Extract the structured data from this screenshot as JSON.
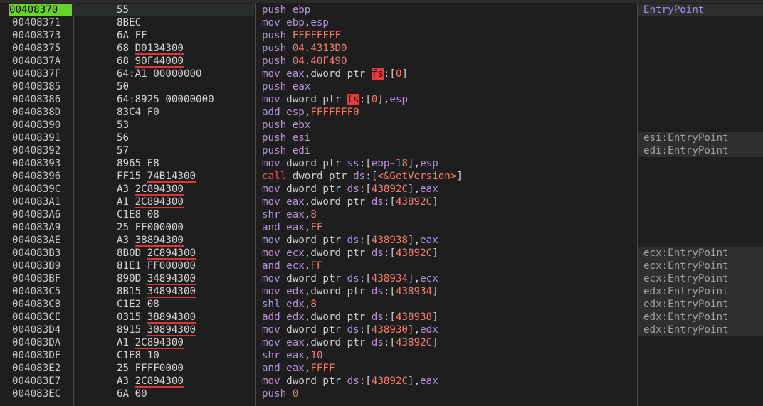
{
  "rows": [
    {
      "addr": "00408370",
      "bytes": [
        [
          "55"
        ]
      ],
      "instr": [
        [
          "mn",
          "push"
        ],
        [
          "s",
          " "
        ],
        [
          "r",
          "ebp"
        ]
      ],
      "comment": "EntryPoint",
      "selected": true
    },
    {
      "addr": "00408371",
      "bytes": [
        [
          "8BEC"
        ]
      ],
      "instr": [
        [
          "mn",
          "mov"
        ],
        [
          "s",
          " "
        ],
        [
          "r",
          "ebp"
        ],
        [
          "p",
          ","
        ],
        [
          "r",
          "esp"
        ]
      ],
      "comment": ""
    },
    {
      "addr": "00408373",
      "bytes": [
        [
          "6A FF"
        ]
      ],
      "instr": [
        [
          "mn",
          "push"
        ],
        [
          "s",
          " "
        ],
        [
          "n",
          "FFFFFFFF"
        ]
      ],
      "comment": ""
    },
    {
      "addr": "00408375",
      "bytes": [
        [
          "68 "
        ],
        [
          "u",
          "D0134300"
        ]
      ],
      "instr": [
        [
          "mn",
          "push"
        ],
        [
          "s",
          " "
        ],
        [
          "n",
          "04.4313D0"
        ]
      ],
      "comment": ""
    },
    {
      "addr": "0040837A",
      "bytes": [
        [
          "68 "
        ],
        [
          "u",
          "90F44000"
        ]
      ],
      "instr": [
        [
          "mn",
          "push"
        ],
        [
          "s",
          " "
        ],
        [
          "n",
          "04.40F490"
        ]
      ],
      "comment": ""
    },
    {
      "addr": "0040837F",
      "bytes": [
        [
          "64:A1 00000000"
        ]
      ],
      "instr": [
        [
          "mn",
          "mov"
        ],
        [
          "s",
          " "
        ],
        [
          "r",
          "eax"
        ],
        [
          "p",
          ","
        ],
        [
          "p",
          "dword ptr "
        ],
        [
          "fs",
          "fs"
        ],
        [
          "p",
          ":["
        ],
        [
          "n",
          "0"
        ],
        [
          "p",
          "]"
        ]
      ],
      "comment": ""
    },
    {
      "addr": "00408385",
      "bytes": [
        [
          "50"
        ]
      ],
      "instr": [
        [
          "mn",
          "push"
        ],
        [
          "s",
          " "
        ],
        [
          "r",
          "eax"
        ]
      ],
      "comment": ""
    },
    {
      "addr": "00408386",
      "bytes": [
        [
          "64:8925 00000000"
        ]
      ],
      "instr": [
        [
          "mn",
          "mov"
        ],
        [
          "s",
          " "
        ],
        [
          "p",
          "dword ptr "
        ],
        [
          "fs",
          "fs"
        ],
        [
          "p",
          ":["
        ],
        [
          "n",
          "0"
        ],
        [
          "p",
          "],"
        ],
        [
          "r",
          "esp"
        ]
      ],
      "comment": ""
    },
    {
      "addr": "0040838D",
      "bytes": [
        [
          "83C4 F0"
        ]
      ],
      "instr": [
        [
          "mn",
          "add"
        ],
        [
          "s",
          " "
        ],
        [
          "r",
          "esp"
        ],
        [
          "p",
          ","
        ],
        [
          "n",
          "FFFFFFF0"
        ]
      ],
      "comment": ""
    },
    {
      "addr": "00408390",
      "bytes": [
        [
          "53"
        ]
      ],
      "instr": [
        [
          "mn",
          "push"
        ],
        [
          "s",
          " "
        ],
        [
          "r",
          "ebx"
        ]
      ],
      "comment": ""
    },
    {
      "addr": "00408391",
      "bytes": [
        [
          "56"
        ]
      ],
      "instr": [
        [
          "mn",
          "push"
        ],
        [
          "s",
          " "
        ],
        [
          "r",
          "esi"
        ]
      ],
      "comment": "esi:EntryPoint"
    },
    {
      "addr": "00408392",
      "bytes": [
        [
          "57"
        ]
      ],
      "instr": [
        [
          "mn",
          "push"
        ],
        [
          "s",
          " "
        ],
        [
          "r",
          "edi"
        ]
      ],
      "comment": "edi:EntryPoint"
    },
    {
      "addr": "00408393",
      "bytes": [
        [
          "8965 E8"
        ]
      ],
      "instr": [
        [
          "mn",
          "mov"
        ],
        [
          "s",
          " "
        ],
        [
          "p",
          "dword ptr "
        ],
        [
          "seg",
          "ss"
        ],
        [
          "p",
          ":["
        ],
        [
          "r",
          "ebp"
        ],
        [
          "p",
          "-"
        ],
        [
          "n",
          "18"
        ],
        [
          "p",
          "],"
        ],
        [
          "r",
          "esp"
        ]
      ],
      "comment": ""
    },
    {
      "addr": "00408396",
      "bytes": [
        [
          "FF15 "
        ],
        [
          "u",
          "74B14300"
        ]
      ],
      "instr": [
        [
          "call",
          "call"
        ],
        [
          "s",
          " "
        ],
        [
          "p",
          "dword ptr "
        ],
        [
          "seg",
          "ds"
        ],
        [
          "p",
          ":["
        ],
        [
          "sym",
          "<&GetVersion>"
        ],
        [
          "p",
          "]"
        ]
      ],
      "comment": ""
    },
    {
      "addr": "0040839C",
      "bytes": [
        [
          "A3 "
        ],
        [
          "u",
          "2C894300"
        ]
      ],
      "instr": [
        [
          "mn",
          "mov"
        ],
        [
          "s",
          " "
        ],
        [
          "p",
          "dword ptr "
        ],
        [
          "seg",
          "ds"
        ],
        [
          "p",
          ":["
        ],
        [
          "n",
          "43892C"
        ],
        [
          "p",
          "],"
        ],
        [
          "r",
          "eax"
        ]
      ],
      "comment": ""
    },
    {
      "addr": "004083A1",
      "bytes": [
        [
          "A1 "
        ],
        [
          "u",
          "2C894300"
        ]
      ],
      "instr": [
        [
          "mn",
          "mov"
        ],
        [
          "s",
          " "
        ],
        [
          "r",
          "eax"
        ],
        [
          "p",
          ","
        ],
        [
          "p",
          "dword ptr "
        ],
        [
          "seg",
          "ds"
        ],
        [
          "p",
          ":["
        ],
        [
          "n",
          "43892C"
        ],
        [
          "p",
          "]"
        ]
      ],
      "comment": ""
    },
    {
      "addr": "004083A6",
      "bytes": [
        [
          "C1E8 08"
        ]
      ],
      "instr": [
        [
          "mn",
          "shr"
        ],
        [
          "s",
          " "
        ],
        [
          "r",
          "eax"
        ],
        [
          "p",
          ","
        ],
        [
          "n",
          "8"
        ]
      ],
      "comment": ""
    },
    {
      "addr": "004083A9",
      "bytes": [
        [
          "25 FF000000"
        ]
      ],
      "instr": [
        [
          "mn",
          "and"
        ],
        [
          "s",
          " "
        ],
        [
          "r",
          "eax"
        ],
        [
          "p",
          ","
        ],
        [
          "n",
          "FF"
        ]
      ],
      "comment": ""
    },
    {
      "addr": "004083AE",
      "bytes": [
        [
          "A3 "
        ],
        [
          "u",
          "38894300"
        ]
      ],
      "instr": [
        [
          "mn",
          "mov"
        ],
        [
          "s",
          " "
        ],
        [
          "p",
          "dword ptr "
        ],
        [
          "seg",
          "ds"
        ],
        [
          "p",
          ":["
        ],
        [
          "n",
          "438938"
        ],
        [
          "p",
          "],"
        ],
        [
          "r",
          "eax"
        ]
      ],
      "comment": ""
    },
    {
      "addr": "004083B3",
      "bytes": [
        [
          "8B0D "
        ],
        [
          "u",
          "2C894300"
        ]
      ],
      "instr": [
        [
          "mn",
          "mov"
        ],
        [
          "s",
          " "
        ],
        [
          "r",
          "ecx"
        ],
        [
          "p",
          ","
        ],
        [
          "p",
          "dword ptr "
        ],
        [
          "seg",
          "ds"
        ],
        [
          "p",
          ":["
        ],
        [
          "n",
          "43892C"
        ],
        [
          "p",
          "]"
        ]
      ],
      "comment": "ecx:EntryPoint"
    },
    {
      "addr": "004083B9",
      "bytes": [
        [
          "81E1 FF000000"
        ]
      ],
      "instr": [
        [
          "mn",
          "and"
        ],
        [
          "s",
          " "
        ],
        [
          "r",
          "ecx"
        ],
        [
          "p",
          ","
        ],
        [
          "n",
          "FF"
        ]
      ],
      "comment": "ecx:EntryPoint"
    },
    {
      "addr": "004083BF",
      "bytes": [
        [
          "890D "
        ],
        [
          "u",
          "34894300"
        ]
      ],
      "instr": [
        [
          "mn",
          "mov"
        ],
        [
          "s",
          " "
        ],
        [
          "p",
          "dword ptr "
        ],
        [
          "seg",
          "ds"
        ],
        [
          "p",
          ":["
        ],
        [
          "n",
          "438934"
        ],
        [
          "p",
          "],"
        ],
        [
          "r",
          "ecx"
        ]
      ],
      "comment": "ecx:EntryPoint"
    },
    {
      "addr": "004083C5",
      "bytes": [
        [
          "8B15 "
        ],
        [
          "u",
          "34894300"
        ]
      ],
      "instr": [
        [
          "mn",
          "mov"
        ],
        [
          "s",
          " "
        ],
        [
          "r",
          "edx"
        ],
        [
          "p",
          ","
        ],
        [
          "p",
          "dword ptr "
        ],
        [
          "seg",
          "ds"
        ],
        [
          "p",
          ":["
        ],
        [
          "n",
          "438934"
        ],
        [
          "p",
          "]"
        ]
      ],
      "comment": "edx:EntryPoint"
    },
    {
      "addr": "004083CB",
      "bytes": [
        [
          "C1E2 08"
        ]
      ],
      "instr": [
        [
          "mn",
          "shl"
        ],
        [
          "s",
          " "
        ],
        [
          "r",
          "edx"
        ],
        [
          "p",
          ","
        ],
        [
          "n",
          "8"
        ]
      ],
      "comment": "edx:EntryPoint"
    },
    {
      "addr": "004083CE",
      "bytes": [
        [
          "0315 "
        ],
        [
          "u",
          "38894300"
        ]
      ],
      "instr": [
        [
          "mn",
          "add"
        ],
        [
          "s",
          " "
        ],
        [
          "r",
          "edx"
        ],
        [
          "p",
          ","
        ],
        [
          "p",
          "dword ptr "
        ],
        [
          "seg",
          "ds"
        ],
        [
          "p",
          ":["
        ],
        [
          "n",
          "438938"
        ],
        [
          "p",
          "]"
        ]
      ],
      "comment": "edx:EntryPoint"
    },
    {
      "addr": "004083D4",
      "bytes": [
        [
          "8915 "
        ],
        [
          "u",
          "30894300"
        ]
      ],
      "instr": [
        [
          "mn",
          "mov"
        ],
        [
          "s",
          " "
        ],
        [
          "p",
          "dword ptr "
        ],
        [
          "seg",
          "ds"
        ],
        [
          "p",
          ":["
        ],
        [
          "n",
          "438930"
        ],
        [
          "p",
          "],"
        ],
        [
          "r",
          "edx"
        ]
      ],
      "comment": "edx:EntryPoint"
    },
    {
      "addr": "004083DA",
      "bytes": [
        [
          "A1 "
        ],
        [
          "u",
          "2C894300"
        ]
      ],
      "instr": [
        [
          "mn",
          "mov"
        ],
        [
          "s",
          " "
        ],
        [
          "r",
          "eax"
        ],
        [
          "p",
          ","
        ],
        [
          "p",
          "dword ptr "
        ],
        [
          "seg",
          "ds"
        ],
        [
          "p",
          ":["
        ],
        [
          "n",
          "43892C"
        ],
        [
          "p",
          "]"
        ]
      ],
      "comment": ""
    },
    {
      "addr": "004083DF",
      "bytes": [
        [
          "C1E8 10"
        ]
      ],
      "instr": [
        [
          "mn",
          "shr"
        ],
        [
          "s",
          " "
        ],
        [
          "r",
          "eax"
        ],
        [
          "p",
          ","
        ],
        [
          "n",
          "10"
        ]
      ],
      "comment": ""
    },
    {
      "addr": "004083E2",
      "bytes": [
        [
          "25 FFFF0000"
        ]
      ],
      "instr": [
        [
          "mn",
          "and"
        ],
        [
          "s",
          " "
        ],
        [
          "r",
          "eax"
        ],
        [
          "p",
          ","
        ],
        [
          "n",
          "FFFF"
        ]
      ],
      "comment": ""
    },
    {
      "addr": "004083E7",
      "bytes": [
        [
          "A3 "
        ],
        [
          "u",
          "2C894300"
        ]
      ],
      "instr": [
        [
          "mn",
          "mov"
        ],
        [
          "s",
          " "
        ],
        [
          "p",
          "dword ptr "
        ],
        [
          "seg",
          "ds"
        ],
        [
          "p",
          ":["
        ],
        [
          "n",
          "43892C"
        ],
        [
          "p",
          "],"
        ],
        [
          "r",
          "eax"
        ]
      ],
      "comment": ""
    },
    {
      "addr": "004083EC",
      "bytes": [
        [
          "6A 00"
        ]
      ],
      "instr": [
        [
          "mn",
          "push"
        ],
        [
          "s",
          " "
        ],
        [
          "n",
          "0"
        ]
      ],
      "comment": ""
    }
  ],
  "colors": {
    "background": "#1e1e1e",
    "selected_address": "#67d42c",
    "mnemonic": "#b992de",
    "call_mnemonic": "#ee5555",
    "number": "#f07e6e",
    "fs_highlight": "#e83a3a",
    "underline": "#e03434",
    "comment": "#a2a2a2"
  }
}
